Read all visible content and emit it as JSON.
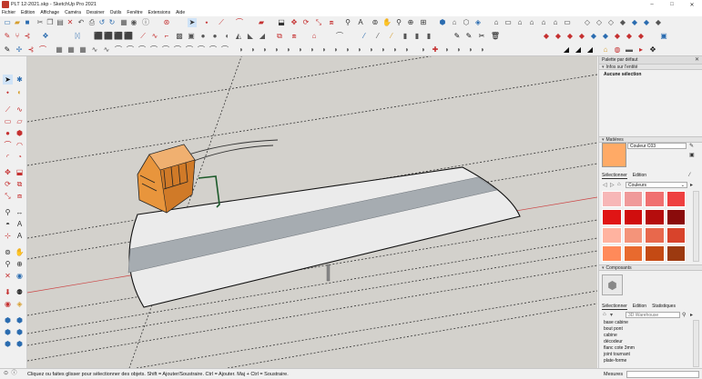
{
  "window": {
    "title": "PLT 12-2021.skp - SketchUp Pro 2021",
    "minimize": "–",
    "maximize": "□",
    "close": "✕"
  },
  "menu": [
    "Fichier",
    "Edition",
    "Affichage",
    "Caméra",
    "Dessiner",
    "Outils",
    "Fenêtre",
    "Extensions",
    "Aide"
  ],
  "tray": {
    "title": "Palette par défaut",
    "entity_info": {
      "header": "Infos sur l'entité",
      "selection": "Aucune sélection"
    },
    "materials": {
      "header": "Matières",
      "material_name": "Couleur C03",
      "swatch_color": "#ffaa66",
      "tabs": [
        "Sélectionner",
        "Edition"
      ],
      "library": "Couleurs",
      "palette_colors": [
        "#f7b7b7",
        "#f09a9a",
        "#f07070",
        "#ee4040",
        "#e01515",
        "#d00e0e",
        "#b50d0d",
        "#8a0b0b",
        "#ffb3a0",
        "#f4947a",
        "#e8684c",
        "#d8432b",
        "#ff8a5a",
        "#e86a2e",
        "#c44a14",
        "#9c3a10"
      ]
    },
    "components": {
      "header": "Composants",
      "tabs": [
        "Sélectionner",
        "Edition",
        "Statistiques"
      ],
      "search_placeholder": "3D Warehouse",
      "items": [
        "base cabine",
        "bout pont",
        "cabine",
        "décodeur",
        "flanc cote 3mm",
        "joint tournant",
        "plate-forme"
      ]
    }
  },
  "status": {
    "hint": "Cliquez ou faites glisser pour sélectionner des objets. Shift = Ajouter/Soustraire. Ctrl = Ajouter. Maj + Ctrl = Soustraire.",
    "measures_label": "Mesures"
  },
  "icons": {
    "toolbar1": [
      "new-icon",
      "open-icon",
      "save-icon",
      "cut-icon",
      "copy-icon",
      "paste-icon",
      "erase-icon",
      "undo-icon",
      "redo-icon",
      "print-icon",
      "model-info-icon",
      "select-icon",
      "eraser-icon",
      "line-icon",
      "arc-icon",
      "shapes-icon",
      "pushpull-icon",
      "move-icon",
      "rotate-icon",
      "scale-icon",
      "offset-icon",
      "tape-icon",
      "text-icon",
      "axes-icon",
      "dimension-icon",
      "protractor-icon",
      "orbit-icon",
      "pan-icon",
      "zoom-icon",
      "zoom-extents-icon",
      "iso-view-icon",
      "top-view-icon",
      "front-view-icon",
      "right-view-icon",
      "back-view-icon",
      "left-view-icon",
      "bottom-view-icon",
      "xray-icon",
      "wireframe-icon",
      "hidden-line-icon",
      "shaded-icon",
      "textured-icon",
      "monochrome-icon"
    ],
    "viewport_tools": [
      "select-icon",
      "component-icon",
      "eraser-icon",
      "paint-icon",
      "line-icon",
      "freehand-icon",
      "rectangle-icon",
      "rotated-rect-icon",
      "circle-icon",
      "polygon-icon",
      "arc-icon",
      "arc-2pt-icon",
      "arc-3pt-icon",
      "pie-icon",
      "move-icon",
      "pushpull-icon",
      "rotate-icon",
      "followme-icon",
      "scale-icon",
      "offset-icon",
      "tape-icon",
      "dimension-icon",
      "protractor-icon",
      "text-icon",
      "axes-icon",
      "3dtext-icon",
      "orbit-icon",
      "pan-icon",
      "zoom-icon",
      "zoom-window-icon",
      "zoom-extents-icon",
      "position-camera-icon",
      "walk-icon",
      "look-around-icon",
      "section-icon"
    ]
  }
}
